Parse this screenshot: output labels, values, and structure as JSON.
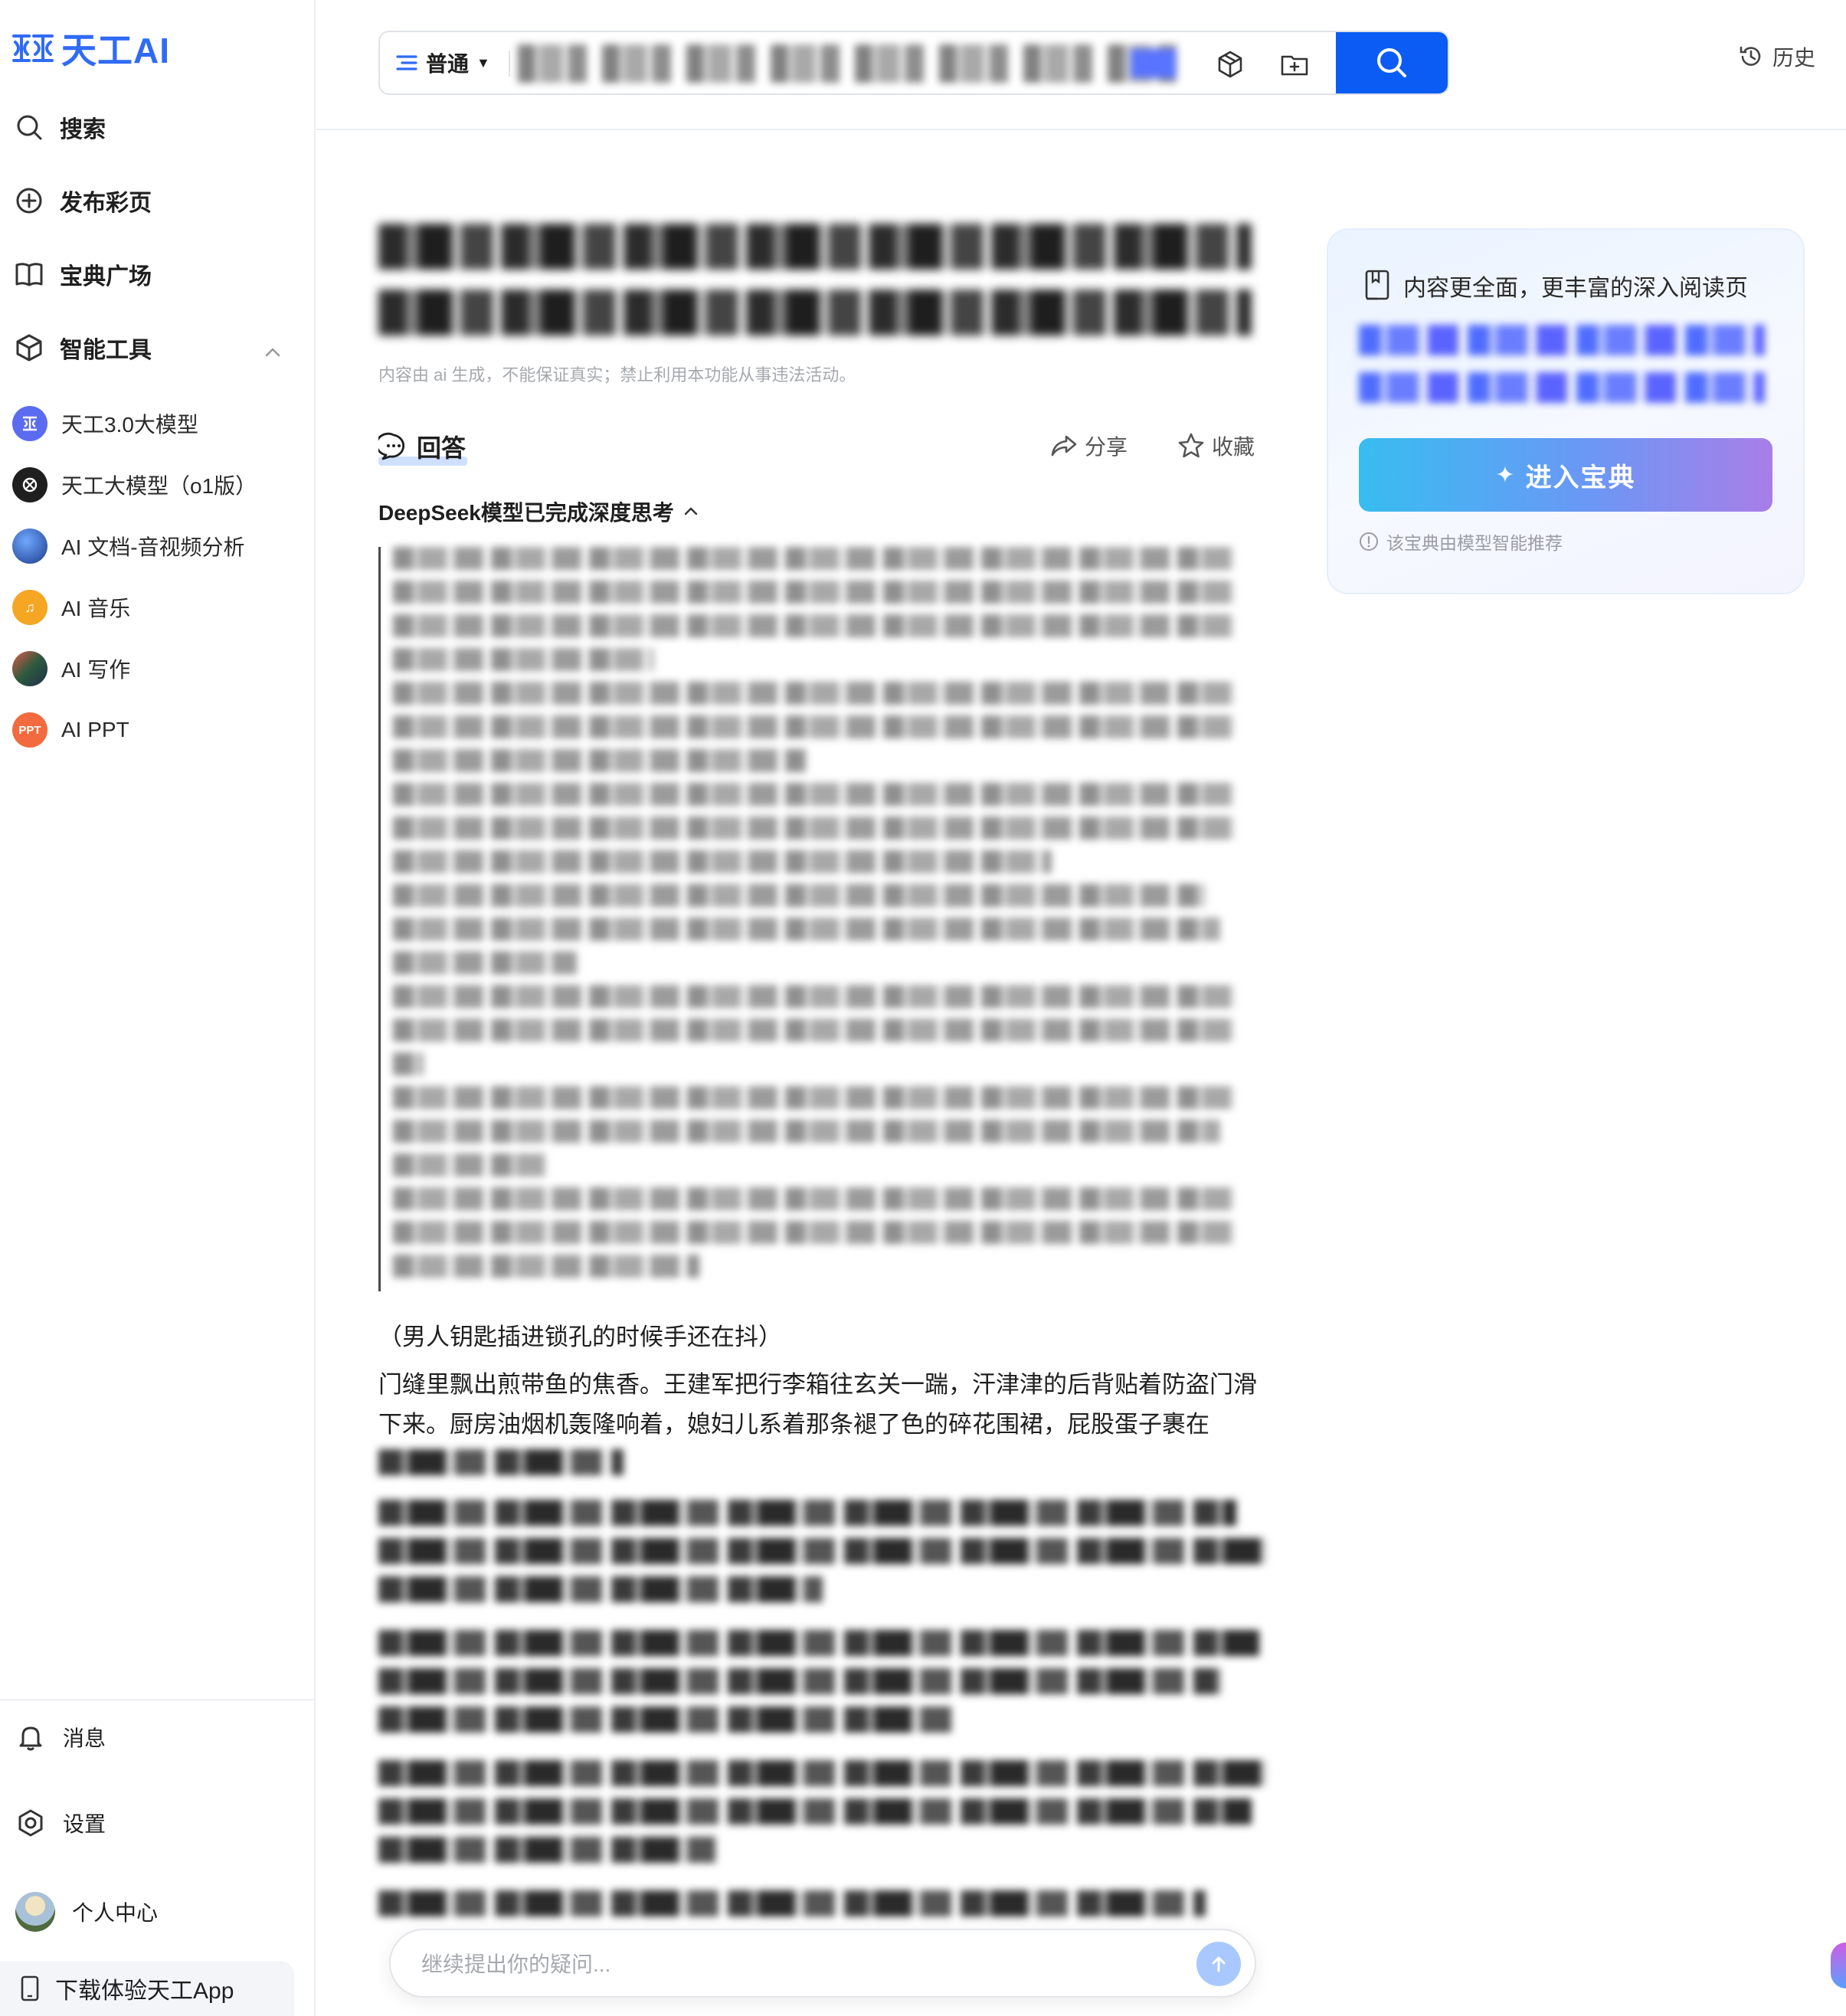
{
  "app": {
    "logo_text": "天工AI"
  },
  "sidebar": {
    "nav": [
      {
        "label": "搜索",
        "icon": "search-icon"
      },
      {
        "label": "发布彩页",
        "icon": "plus-circle-icon"
      },
      {
        "label": "宝典广场",
        "icon": "book-icon"
      },
      {
        "label": "智能工具",
        "icon": "cube-icon"
      }
    ],
    "tools": [
      {
        "label": "天工3.0大模型",
        "icon": "tiangong-3-icon",
        "color": "#5b6cf0"
      },
      {
        "label": "天工大模型（o1版）",
        "icon": "tiangong-o1-icon",
        "color": "#1f1f1f"
      },
      {
        "label": "AI 文档-音视频分析",
        "icon": "doc-av-icon",
        "color": "#2e4fa8"
      },
      {
        "label": "AI 音乐",
        "icon": "music-icon",
        "color": "#f5a623"
      },
      {
        "label": "AI 写作",
        "icon": "writing-icon",
        "color": "#2d5a3d"
      },
      {
        "label": "AI PPT",
        "icon": "ppt-icon",
        "color": "#f26a3d",
        "badge": "PPT"
      }
    ],
    "bottom": [
      {
        "label": "消息",
        "icon": "bell-icon"
      },
      {
        "label": "设置",
        "icon": "settings-icon"
      },
      {
        "label": "个人中心",
        "icon": "avatar"
      }
    ],
    "download": "下载体验天工App"
  },
  "topbar": {
    "mode": "普通",
    "history": "历史"
  },
  "main": {
    "disclaimer": "内容由 ai 生成，不能保证真实；禁止利用本功能从事违法活动。",
    "answer_tab": "回答",
    "share": "分享",
    "favorite": "收藏",
    "thinking_status": "DeepSeek模型已完成深度思考",
    "scene_note": "（男人钥匙插进锁孔的时候手还在抖）",
    "paragraph_1": "门缝里飘出煎带鱼的焦香。王建军把行李箱往玄关一踹，汗津津的后背贴着防盗门滑下来。厨房油烟机轰隆响着，媳妇儿系着那条褪了色的碎花围裙，屁股蛋子裹在"
  },
  "ask": {
    "placeholder": "继续提出你的疑问..."
  },
  "card": {
    "heading": "内容更全面，更丰富的深入阅读页",
    "button": "进入宝典",
    "note": "该宝典由模型智能推荐"
  },
  "colors": {
    "brand": "#2f6bf5",
    "search_button": "#0a5cf5"
  }
}
